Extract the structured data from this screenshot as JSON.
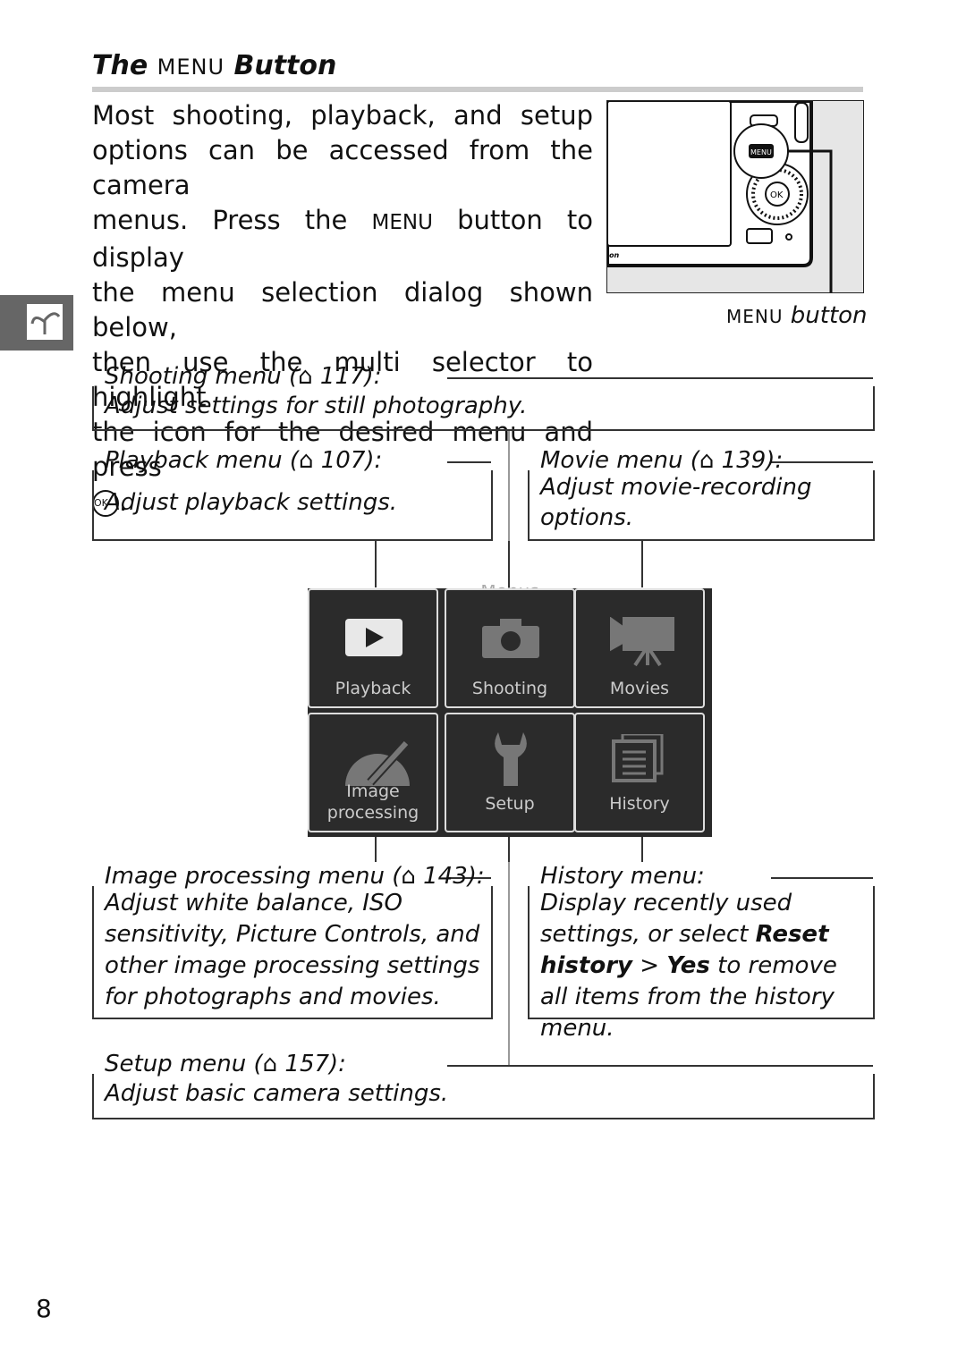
{
  "header": {
    "title_pre": "The",
    "title_menu": "MENU",
    "title_post": "Button"
  },
  "intro": {
    "line1": "Most shooting, playback, and setup",
    "line2": "options can be accessed from the camera",
    "line3a": "menus. Press the",
    "line3menu": "MENU",
    "line3b": "button to display",
    "line4": "the menu selection dialog shown below,",
    "line5": "then use the multi selector to highlight",
    "line6": "the icon for the desired menu and press",
    "ok_symbol": "OK",
    "end": "."
  },
  "figure": {
    "caption_menu": "MENU",
    "caption_text": "button",
    "menu_key": "MENU",
    "ok_key": "OK"
  },
  "callouts": {
    "shooting": {
      "title": "Shooting menu (⌂ 117):",
      "desc": "Adjust settings for still photography."
    },
    "playback": {
      "title": "Playback menu (⌂ 107):",
      "desc": "Adjust playback settings."
    },
    "movie": {
      "title": "Movie menu (⌂ 139):",
      "desc1": "Adjust movie-recording",
      "desc2": "options."
    },
    "image": {
      "title": "Image processing menu (⌂ 143):",
      "desc": "Adjust white balance, ISO sensitivity, Picture Controls, and other image processing settings for photographs and movies."
    },
    "history": {
      "title": "History menu:",
      "desc_a": "Display recently used settings, or select",
      "bold1": "Reset history",
      "sep": ">",
      "bold2": "Yes",
      "desc_b": "to remove all items from the history menu."
    },
    "setup": {
      "title": "Setup menu (⌂ 157):",
      "desc": "Adjust basic camera settings."
    }
  },
  "menu_screen": {
    "title": "Menus",
    "items": [
      {
        "label": "Playback",
        "icon": "play-icon"
      },
      {
        "label": "Shooting",
        "icon": "camera-icon"
      },
      {
        "label": "Movies",
        "icon": "movie-camera-icon"
      },
      {
        "label": "Image",
        "label2": "processing",
        "icon": "brush-icon"
      },
      {
        "label": "Setup",
        "icon": "wrench-icon"
      },
      {
        "label": "History",
        "icon": "history-icon"
      }
    ]
  },
  "page_number": "8"
}
